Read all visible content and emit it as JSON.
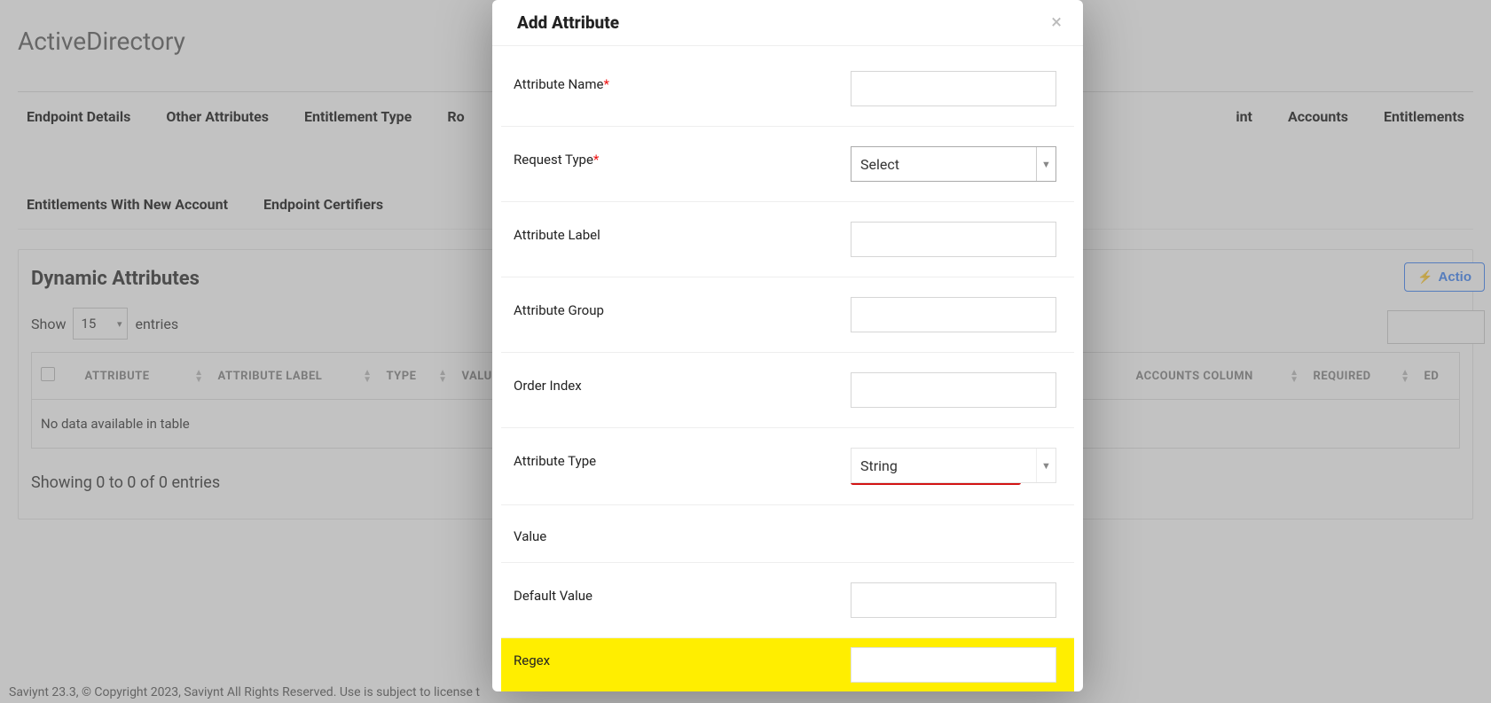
{
  "page": {
    "title": "ActiveDirectory",
    "footer": "Saviynt 23.3, © Copyright 2023, Saviynt All Rights Reserved. Use is subject to license t"
  },
  "tabs": {
    "items": [
      "Endpoint Details",
      "Other Attributes",
      "Entitlement Type",
      "Ro",
      "int",
      "Accounts",
      "Entitlements",
      "Entitlements With New Account",
      "Endpoint Certifiers"
    ]
  },
  "panel": {
    "title": "Dynamic Attributes",
    "actions_label": "Actio",
    "show_label": "Show",
    "entries_label": "entries",
    "page_length": "15",
    "columns": [
      "ATTRIBUTE",
      "ATTRIBUTE LABEL",
      "TYPE",
      "VALUES",
      "ACCOUNTS COLUMN",
      "REQUIRED",
      "ED"
    ],
    "empty_text": "No data available in table",
    "info_text": "Showing 0 to 0 of 0 entries"
  },
  "modal": {
    "title": "Add Attribute",
    "fields": {
      "attribute_name": {
        "label": "Attribute Name",
        "required": true
      },
      "request_type": {
        "label": "Request Type",
        "required": true,
        "value": "Select"
      },
      "attribute_label": {
        "label": "Attribute Label"
      },
      "attribute_group": {
        "label": "Attribute Group"
      },
      "order_index": {
        "label": "Order Index"
      },
      "attribute_type": {
        "label": "Attribute Type",
        "value": "String"
      },
      "value": {
        "label": "Value"
      },
      "default_value": {
        "label": "Default Value"
      },
      "regex": {
        "label": "Regex"
      }
    }
  }
}
